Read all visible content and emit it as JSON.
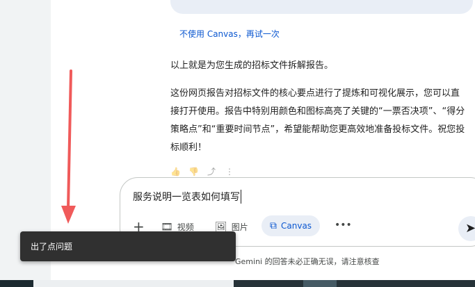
{
  "chat": {
    "retry_link": "不使用 Canvas，再试一次",
    "paragraph_1": "以上就是为您生成的招标文件拆解报告。",
    "paragraph_2": "这份网页报告对招标文件的核心要点进行了提炼和可视化展示，您可以直接打开使用。报告中特别用颜色和图标高亮了关键的“一票否决项”、“得分策略点”和“重要时间节点”，希望能帮助您更高效地准备投标文件。祝您投标顺利！"
  },
  "message_actions": {
    "icons": [
      "thumb-up-icon",
      "thumb-down-icon",
      "share-icon",
      "more-vert-icon"
    ]
  },
  "composer": {
    "input_value": "服务说明一览表如何填写",
    "tools": {
      "video_label": "视频",
      "image_label": "图片",
      "canvas_label": "Canvas",
      "more_label": "•••"
    }
  },
  "disclaimer": "Gemini 的回答未必正确无误，请注意核查",
  "toast": {
    "message": "出了点问题"
  },
  "colors": {
    "accent": "#0b57d0",
    "toast_bg": "#303030",
    "annotation_arrow": "#f05a5a"
  }
}
